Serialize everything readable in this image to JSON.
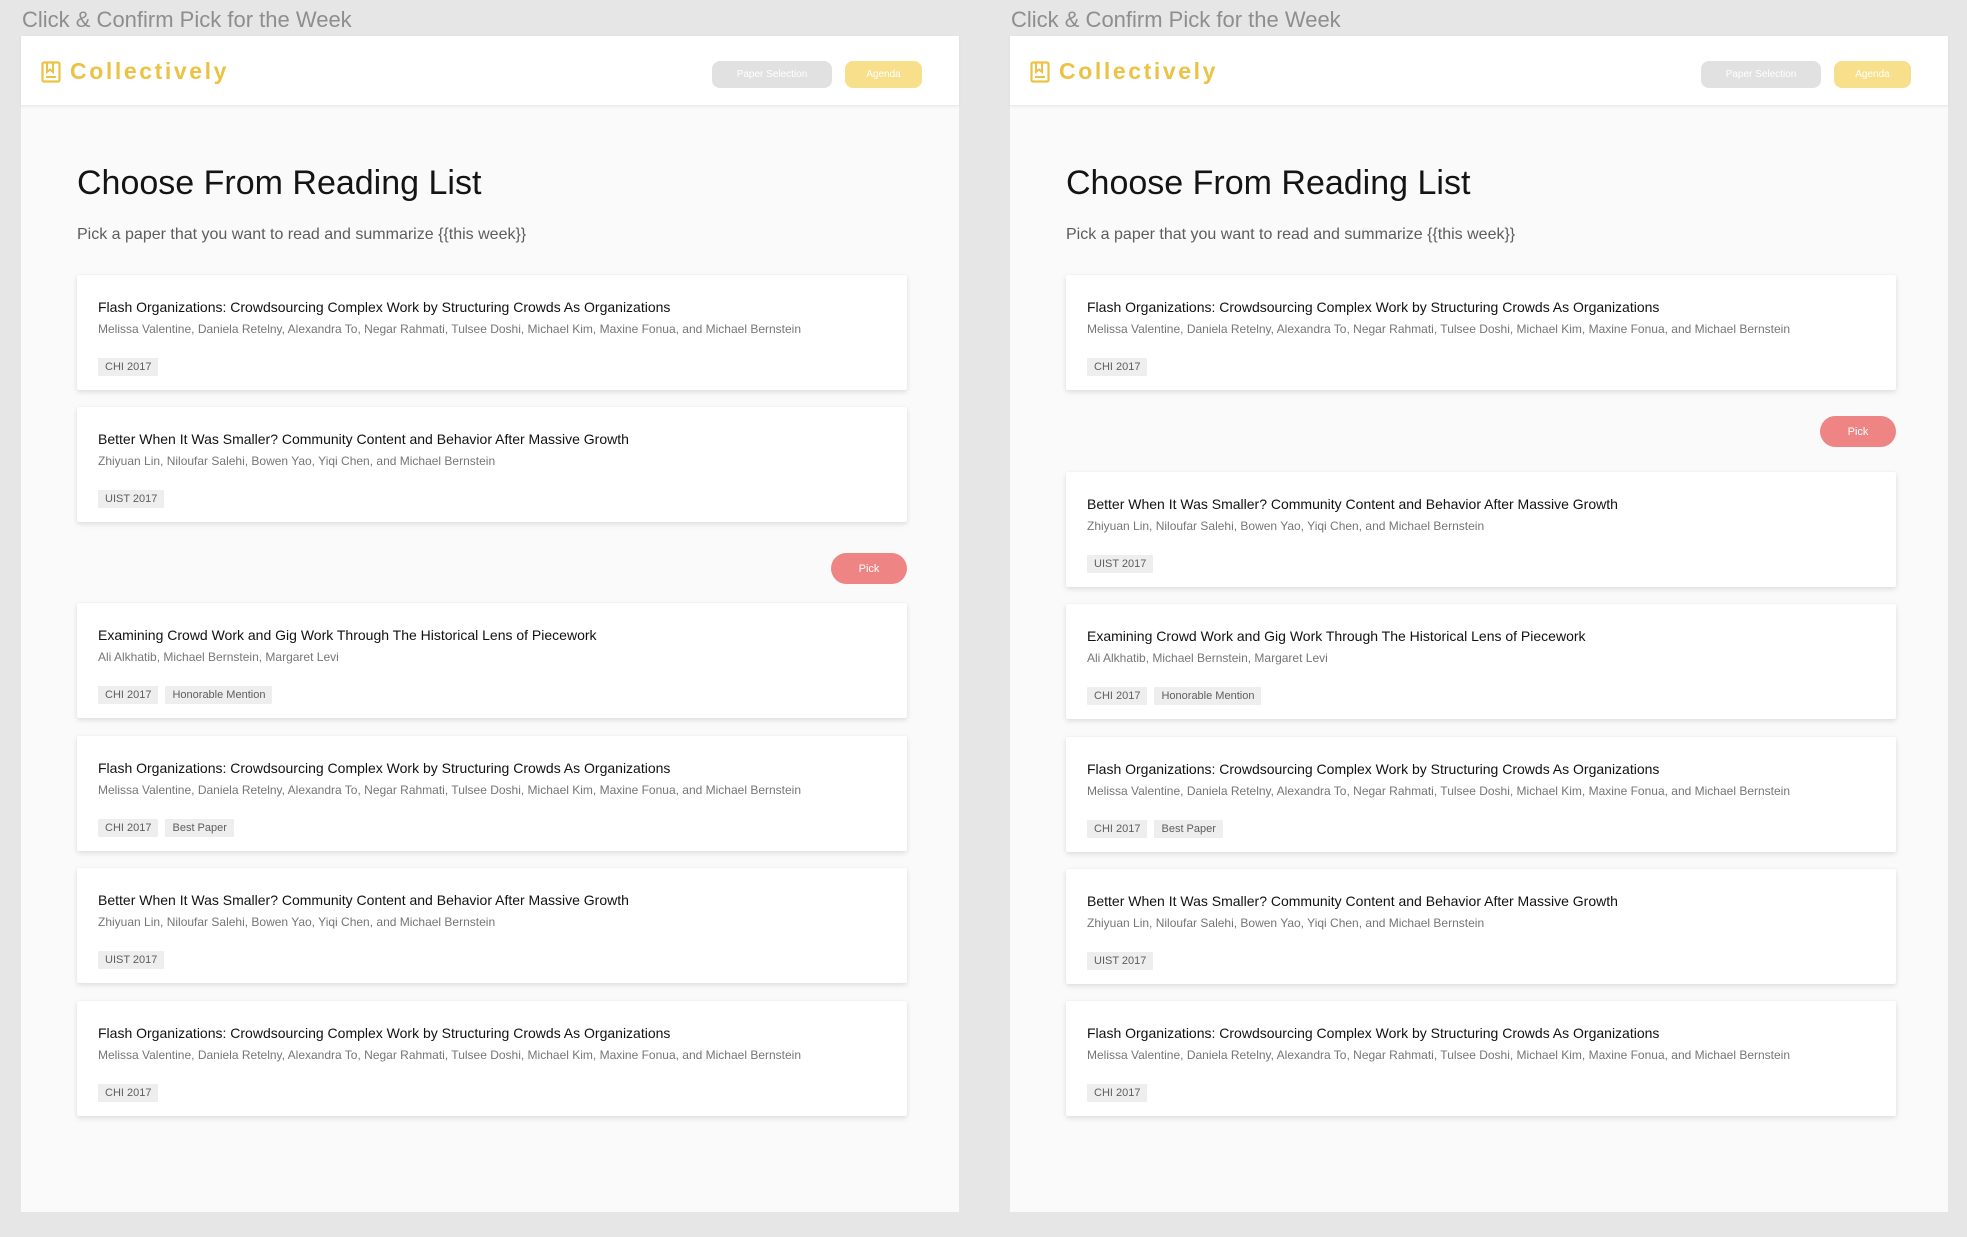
{
  "artboards": [
    {
      "label": "Click & Confirm Pick for the Week",
      "brand": "Collectively",
      "nav": {
        "paper_selection": "Paper Selection",
        "agenda": "Agenda"
      },
      "title": "Choose From Reading List",
      "subtitle": "Pick a paper that you want to read and summarize {{this week}}",
      "pick_label": "Pick",
      "pick_after_card": 2,
      "papers": [
        {
          "title": "Flash Organizations: Crowdsourcing Complex Work by Structuring Crowds As Organizations",
          "authors": "Melissa Valentine, Daniela Retelny, Alexandra To, Negar Rahmati, Tulsee Doshi, Michael Kim, Maxine Fonua, and Michael Bernstein",
          "tags": [
            "CHI 2017"
          ]
        },
        {
          "title": "Better When It Was Smaller? Community Content and Behavior After Massive Growth",
          "authors": "Zhiyuan Lin, Niloufar Salehi, Bowen Yao, Yiqi Chen, and Michael Bernstein",
          "tags": [
            "UIST 2017"
          ]
        },
        {
          "title": "Examining Crowd Work and Gig Work Through The Historical Lens of Piecework",
          "authors": "Ali Alkhatib, Michael Bernstein, Margaret Levi",
          "tags": [
            "CHI 2017",
            "Honorable Mention"
          ]
        },
        {
          "title": "Flash Organizations: Crowdsourcing Complex Work by Structuring Crowds As Organizations",
          "authors": "Melissa Valentine, Daniela Retelny, Alexandra To, Negar Rahmati, Tulsee Doshi, Michael Kim, Maxine Fonua, and Michael Bernstein",
          "tags": [
            "CHI 2017",
            "Best Paper"
          ]
        },
        {
          "title": "Better When It Was Smaller? Community Content and Behavior After Massive Growth",
          "authors": "Zhiyuan Lin, Niloufar Salehi, Bowen Yao, Yiqi Chen, and Michael Bernstein",
          "tags": [
            "UIST 2017"
          ]
        },
        {
          "title": "Flash Organizations: Crowdsourcing Complex Work by Structuring Crowds As Organizations",
          "authors": "Melissa Valentine, Daniela Retelny, Alexandra To, Negar Rahmati, Tulsee Doshi, Michael Kim, Maxine Fonua, and Michael Bernstein",
          "tags": [
            "CHI 2017"
          ]
        }
      ]
    },
    {
      "label": "Click & Confirm Pick for the Week",
      "brand": "Collectively",
      "nav": {
        "paper_selection": "Paper Selection",
        "agenda": "Agenda"
      },
      "title": "Choose From Reading List",
      "subtitle": "Pick a paper that you want to read and summarize {{this week}}",
      "pick_label": "Pick",
      "pick_after_card": 1,
      "papers": [
        {
          "title": "Flash Organizations: Crowdsourcing Complex Work by Structuring Crowds As Organizations",
          "authors": "Melissa Valentine, Daniela Retelny, Alexandra To, Negar Rahmati, Tulsee Doshi, Michael Kim, Maxine Fonua, and Michael Bernstein",
          "tags": [
            "CHI 2017"
          ]
        },
        {
          "title": "Better When It Was Smaller? Community Content and Behavior After Massive Growth",
          "authors": "Zhiyuan Lin, Niloufar Salehi, Bowen Yao, Yiqi Chen, and Michael Bernstein",
          "tags": [
            "UIST 2017"
          ]
        },
        {
          "title": "Examining Crowd Work and Gig Work Through The Historical Lens of Piecework",
          "authors": "Ali Alkhatib, Michael Bernstein, Margaret Levi",
          "tags": [
            "CHI 2017",
            "Honorable Mention"
          ]
        },
        {
          "title": "Flash Organizations: Crowdsourcing Complex Work by Structuring Crowds As Organizations",
          "authors": "Melissa Valentine, Daniela Retelny, Alexandra To, Negar Rahmati, Tulsee Doshi, Michael Kim, Maxine Fonua, and Michael Bernstein",
          "tags": [
            "CHI 2017",
            "Best Paper"
          ]
        },
        {
          "title": "Better When It Was Smaller? Community Content and Behavior After Massive Growth",
          "authors": "Zhiyuan Lin, Niloufar Salehi, Bowen Yao, Yiqi Chen, and Michael Bernstein",
          "tags": [
            "UIST 2017"
          ]
        },
        {
          "title": "Flash Organizations: Crowdsourcing Complex Work by Structuring Crowds As Organizations",
          "authors": "Melissa Valentine, Daniela Retelny, Alexandra To, Negar Rahmati, Tulsee Doshi, Michael Kim, Maxine Fonua, and Michael Bernstein",
          "tags": [
            "CHI 2017"
          ]
        }
      ]
    }
  ],
  "colors": {
    "brand": "#ecc245",
    "pick": "#ee8484",
    "agenda": "#f8df8c",
    "paper_selection": "#e1e1e1"
  },
  "icons": {
    "brand": "bookmark-book-icon"
  }
}
